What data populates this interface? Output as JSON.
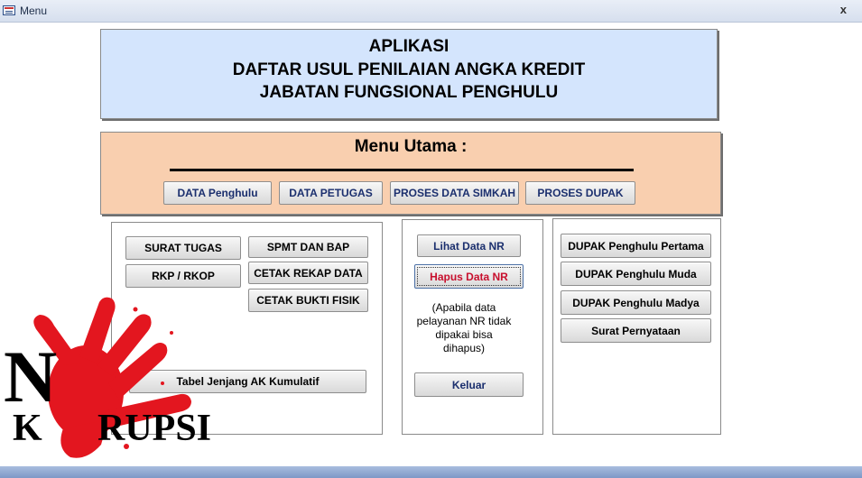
{
  "window": {
    "title": "Menu",
    "close_label": "x"
  },
  "header": {
    "line1": "APLIKASI",
    "line2": "DAFTAR USUL PENILAIAN ANGKA KREDIT",
    "line3": "JABATAN FUNGSIONAL PENGHULU"
  },
  "menu": {
    "title": "Menu Utama :",
    "buttons": [
      "DATA Penghulu",
      "DATA PETUGAS",
      "PROSES DATA SIMKAH",
      "PROSES DUPAK"
    ]
  },
  "left_panel": {
    "surat_tugas": "SURAT TUGAS",
    "rkp": "RKP / RKOP",
    "spmt": "SPMT DAN BAP",
    "cetak_rekap": "CETAK REKAP DATA",
    "cetak_bukti": "CETAK BUKTI FISIK",
    "tabel": "Tabel Jenjang AK Kumulatif"
  },
  "middle_panel": {
    "lihat": "Lihat Data NR",
    "hapus": "Hapus Data NR",
    "note_lines": [
      "(Apabila data",
      "pelayanan NR tidak",
      "dipakai bisa",
      "dihapus)"
    ],
    "keluar": "Keluar"
  },
  "right_panel": {
    "pertama": "DUPAK Penghulu Pertama",
    "muda": "DUPAK Penghulu Muda",
    "madya": "DUPAK Penghulu Madya",
    "pernyataan": "Surat Pernyataan"
  },
  "logo": {
    "text": "NO KORUPSI",
    "hand_color": "#e3161f"
  }
}
